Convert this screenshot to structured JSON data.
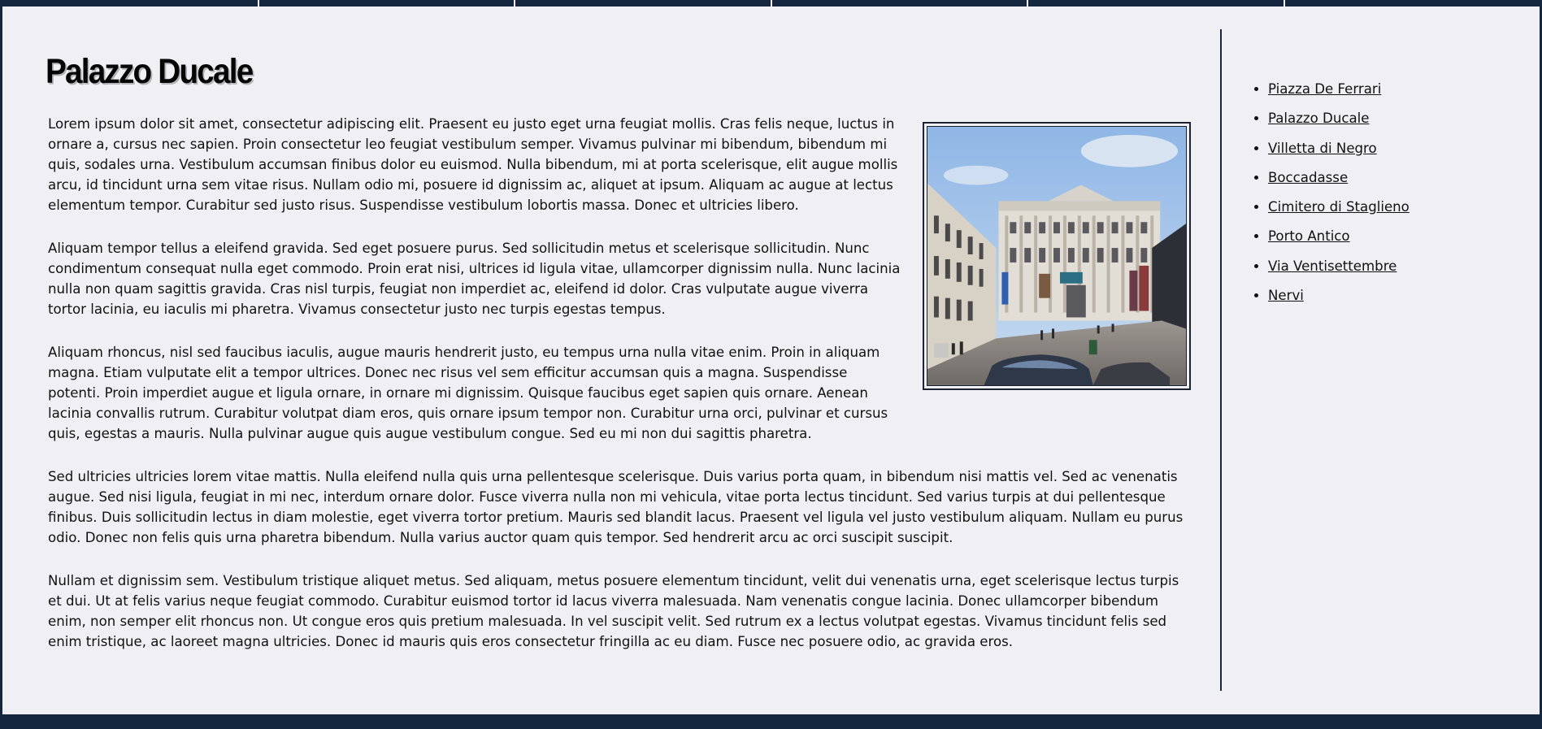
{
  "page": {
    "title": "Palazzo Ducale",
    "paragraphs": [
      "Lorem ipsum dolor sit amet, consectetur adipiscing elit. Praesent eu justo eget urna feugiat mollis. Cras felis neque, luctus in ornare a, cursus nec sapien. Proin consectetur leo feugiat vestibulum semper. Vivamus pulvinar mi bibendum, bibendum mi quis, sodales urna. Vestibulum accumsan finibus dolor eu euismod. Nulla bibendum, mi at porta scelerisque, elit augue mollis arcu, id tincidunt urna sem vitae risus. Nullam odio mi, posuere id dignissim ac, aliquet at ipsum. Aliquam ac augue at lectus elementum tempor. Curabitur sed justo risus. Suspendisse vestibulum lobortis massa. Donec et ultricies libero.",
      "Aliquam tempor tellus a eleifend gravida. Sed eget posuere purus. Sed sollicitudin metus et scelerisque sollicitudin. Nunc condimentum consequat nulla eget commodo. Proin erat nisi, ultrices id ligula vitae, ullamcorper dignissim nulla. Nunc lacinia nulla non quam sagittis gravida. Cras nisl turpis, feugiat non imperdiet ac, eleifend id dolor. Cras vulputate augue viverra tortor lacinia, eu iaculis mi pharetra. Vivamus consectetur justo nec turpis egestas tempus.",
      "Aliquam rhoncus, nisl sed faucibus iaculis, augue mauris hendrerit justo, eu tempus urna nulla vitae enim. Proin in aliquam magna. Etiam vulputate elit a tempor ultrices. Donec nec risus vel sem efficitur accumsan quis a magna. Suspendisse potenti. Proin imperdiet augue et ligula ornare, in ornare mi dignissim. Quisque faucibus eget sapien quis ornare. Aenean lacinia convallis rutrum. Curabitur volutpat diam eros, quis ornare ipsum tempor non. Curabitur urna orci, pulvinar et cursus quis, egestas a mauris. Nulla pulvinar augue quis augue vestibulum congue. Sed eu mi non dui sagittis pharetra.",
      "Sed ultricies ultricies lorem vitae mattis. Nulla eleifend nulla quis urna pellentesque scelerisque. Duis varius porta quam, in bibendum nisi mattis vel. Sed ac venenatis augue. Sed nisi ligula, feugiat in mi nec, interdum ornare dolor. Fusce viverra nulla non mi vehicula, vitae porta lectus tincidunt. Sed varius turpis at dui pellentesque finibus. Duis sollicitudin lectus in diam molestie, eget viverra tortor pretium. Mauris sed blandit lacus. Praesent vel ligula vel justo vestibulum aliquam. Nullam eu purus odio. Donec non felis quis urna pharetra bibendum. Nulla varius auctor quam quis tempor. Sed hendrerit arcu ac orci suscipit suscipit.",
      "Nullam et dignissim sem. Vestibulum tristique aliquet metus. Sed aliquam, metus posuere elementum tincidunt, velit dui venenatis urna, eget scelerisque lectus turpis et dui. Ut at felis varius neque feugiat commodo. Curabitur euismod tortor id lacus viverra malesuada. Nam venenatis congue lacinia. Donec ullamcorper bibendum enim, non semper elit rhoncus non. Ut congue eros quis pretium malesuada. In vel suscipit velit. Sed rutrum ex a lectus volutpat egestas. Vivamus tincidunt felis sed enim tristique, ac laoreet magna ultricies. Donec id mauris quis eros consectetur fringilla ac eu diam. Fusce nec posuere odio, ac gravida eros."
    ]
  },
  "sidebar": {
    "links": [
      "Piazza De Ferrari",
      "Palazzo Ducale",
      "Villetta di Negro",
      "Boccadasse",
      "Cimitero di Staglieno",
      "Porto Antico",
      "Via Ventisettembre",
      "Nervi"
    ]
  },
  "colors": {
    "navy": "#14273e",
    "background": "#f0eff4",
    "text": "#111111"
  },
  "icons": {
    "photo": "palazzo-ducale-photo"
  }
}
